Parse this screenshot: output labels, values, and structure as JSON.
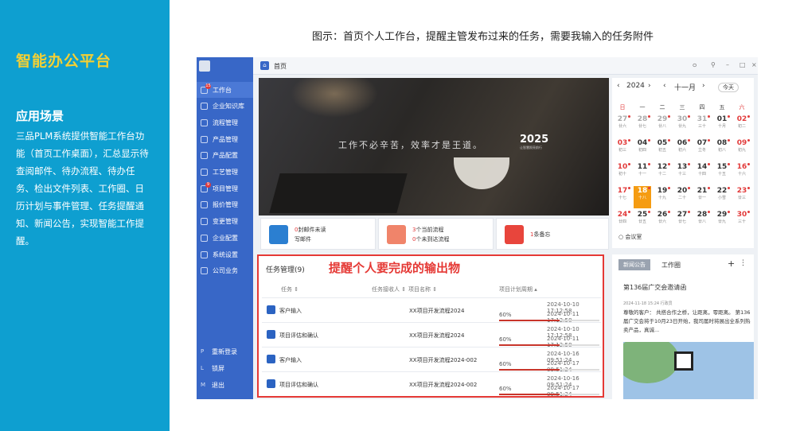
{
  "brand": "智能办公平台",
  "scenario": {
    "title": "应用场景",
    "desc": "三品PLM系统提供智能工作台功能（首页工作桌面），汇总显示待查阅邮件、待办流程、待办任务、检出文件列表、工作圈、日历计划与事件管理、任务提醒通知、新闻公告，实现智能工作提醒。"
  },
  "caption": "图示：首页个人工作台，提醒主管发布过来的任务，需要我输入的任务附件",
  "sidebar": {
    "items": [
      {
        "label": "工作台",
        "badge": "15"
      },
      {
        "label": "企业知识库"
      },
      {
        "label": "流程管理"
      },
      {
        "label": "产品管理"
      },
      {
        "label": "产品配置"
      },
      {
        "label": "工艺管理"
      },
      {
        "label": "项目管理",
        "badge": "9"
      },
      {
        "label": "报价管理"
      },
      {
        "label": "变更管理"
      },
      {
        "label": "企业配置"
      },
      {
        "label": "系统设置"
      },
      {
        "label": "公司业务"
      }
    ],
    "bottom": [
      {
        "key": "P",
        "label": "重新登录"
      },
      {
        "key": "L",
        "label": "锁屏"
      },
      {
        "key": "M",
        "label": "退出"
      }
    ]
  },
  "topbar": {
    "tab": "首页",
    "buttons": [
      "ㅇ",
      "⚲",
      "–",
      "□",
      "×"
    ]
  },
  "banner": {
    "slogan": "工作不必辛苦，效率才是王道。",
    "logo": "2025",
    "logo_sub": "让智慧照亮前行"
  },
  "cards": [
    {
      "count": "0",
      "l1": "封邮件未读",
      "l2": "写邮件",
      "color": "#2b7fd1"
    },
    {
      "count": "3",
      "l1": "个当前流程",
      "count2": "0",
      "l2": "个未到达流程",
      "color": "#f0846a"
    },
    {
      "count": "1",
      "l1": "条备忘",
      "color": "#e8453c"
    }
  ],
  "calendar": {
    "year": "2024",
    "month": "十一月",
    "today_btn": "今天",
    "weekdays": [
      "日",
      "一",
      "二",
      "三",
      "四",
      "五",
      "六"
    ],
    "days": [
      {
        "d": "27",
        "l": "廿六",
        "g": 1
      },
      {
        "d": "28",
        "l": "廿七",
        "g": 1
      },
      {
        "d": "29",
        "l": "廿八",
        "g": 1
      },
      {
        "d": "30",
        "l": "廿九",
        "g": 1
      },
      {
        "d": "31",
        "l": "三十",
        "g": 1
      },
      {
        "d": "01",
        "l": "十月"
      },
      {
        "d": "02",
        "l": "初二"
      },
      {
        "d": "03",
        "l": "初三"
      },
      {
        "d": "04",
        "l": "初四"
      },
      {
        "d": "05",
        "l": "初五"
      },
      {
        "d": "06",
        "l": "初六"
      },
      {
        "d": "07",
        "l": "立冬"
      },
      {
        "d": "08",
        "l": "初八"
      },
      {
        "d": "09",
        "l": "初九"
      },
      {
        "d": "10",
        "l": "初十"
      },
      {
        "d": "11",
        "l": "十一"
      },
      {
        "d": "12",
        "l": "十二"
      },
      {
        "d": "13",
        "l": "十三"
      },
      {
        "d": "14",
        "l": "十四"
      },
      {
        "d": "15",
        "l": "十五"
      },
      {
        "d": "16",
        "l": "十六"
      },
      {
        "d": "17",
        "l": "十七"
      },
      {
        "d": "18",
        "l": "十八",
        "t": 1
      },
      {
        "d": "19",
        "l": "十九"
      },
      {
        "d": "20",
        "l": "二十"
      },
      {
        "d": "21",
        "l": "廿一"
      },
      {
        "d": "22",
        "l": "小雪"
      },
      {
        "d": "23",
        "l": "廿三"
      },
      {
        "d": "24",
        "l": "廿四"
      },
      {
        "d": "25",
        "l": "廿五"
      },
      {
        "d": "26",
        "l": "廿六"
      },
      {
        "d": "27",
        "l": "廿七"
      },
      {
        "d": "28",
        "l": "廿八"
      },
      {
        "d": "29",
        "l": "廿九"
      },
      {
        "d": "30",
        "l": "三十"
      }
    ],
    "footer": "会议室"
  },
  "tasks": {
    "title": "任务管理(9)",
    "note": "提醒个人要完成的输出物",
    "headers": [
      "任务 ⇕",
      "任务接收人 ⇕",
      "项目名称 ⇕",
      "项目计划周期 ▴"
    ],
    "rows": [
      {
        "task": "客户输入",
        "project": "XX项目开发流程2024",
        "pct": "60%",
        "p": 0.6,
        "start": "2024-10-10 17:12:58",
        "end": "2024-10-11 17:12:58"
      },
      {
        "task": "项目评估和确认",
        "project": "XX项目开发流程2024",
        "pct": "60%",
        "p": 0.6,
        "start": "2024-10-10 17:12:58",
        "end": "2024-10-11 17:12:58"
      },
      {
        "task": "客户输入",
        "project": "XX项目开发流程2024-002",
        "pct": "60%",
        "p": 0.6,
        "start": "2024-10-16 09:51:24",
        "end": "2024-10-17 09:51:24"
      },
      {
        "task": "项目评估和确认",
        "project": "XX项目开发流程2024-002",
        "pct": "60%",
        "p": 0.6,
        "start": "2024-10-16 09:51:24",
        "end": "2024-10-17 09:51:24"
      }
    ]
  },
  "news": {
    "tab1": "新闻公告",
    "tab2": "工作圈",
    "title": "第136届广交会邀请函",
    "meta": "2024-11-18 15:24 行政员",
    "body": "尊敬的客户：   共搭合作之桥，让距离，零距离。   第136届广交会将于10月23日开始，我司届时将展出全系列热卖产品，真诚..."
  }
}
